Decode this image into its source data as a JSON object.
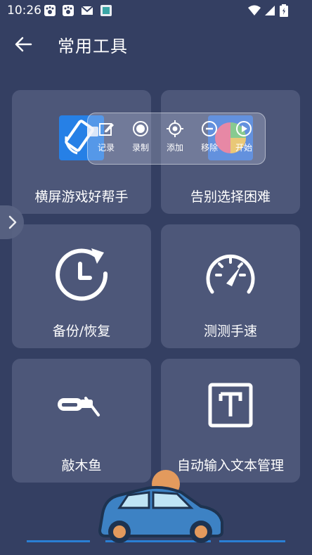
{
  "status_bar": {
    "time": "10:26"
  },
  "appbar": {
    "title": "常用工具"
  },
  "floating_toolbar": {
    "items": [
      {
        "label": "记录",
        "icon": "edit-icon"
      },
      {
        "label": "录制",
        "icon": "record-icon"
      },
      {
        "label": "添加",
        "icon": "target-icon"
      },
      {
        "label": "移除",
        "icon": "minus-circle-icon"
      },
      {
        "label": "开始",
        "icon": "play-icon"
      }
    ]
  },
  "cards": [
    {
      "label": "横屏游戏好帮手",
      "icon": "rotate-screen-icon"
    },
    {
      "label": "告别选择困难",
      "icon": "wheel-icon"
    },
    {
      "label": "备份/恢复",
      "icon": "clock-refresh-icon"
    },
    {
      "label": "测测手速",
      "icon": "speedometer-icon"
    },
    {
      "label": "敲木鱼",
      "icon": "wooden-fish-icon"
    },
    {
      "label": "自动输入文本管理",
      "icon": "text-box-icon"
    }
  ],
  "colors": {
    "background": "#343f62",
    "card": "#4d5779",
    "accent_blue": "#2680e6"
  }
}
